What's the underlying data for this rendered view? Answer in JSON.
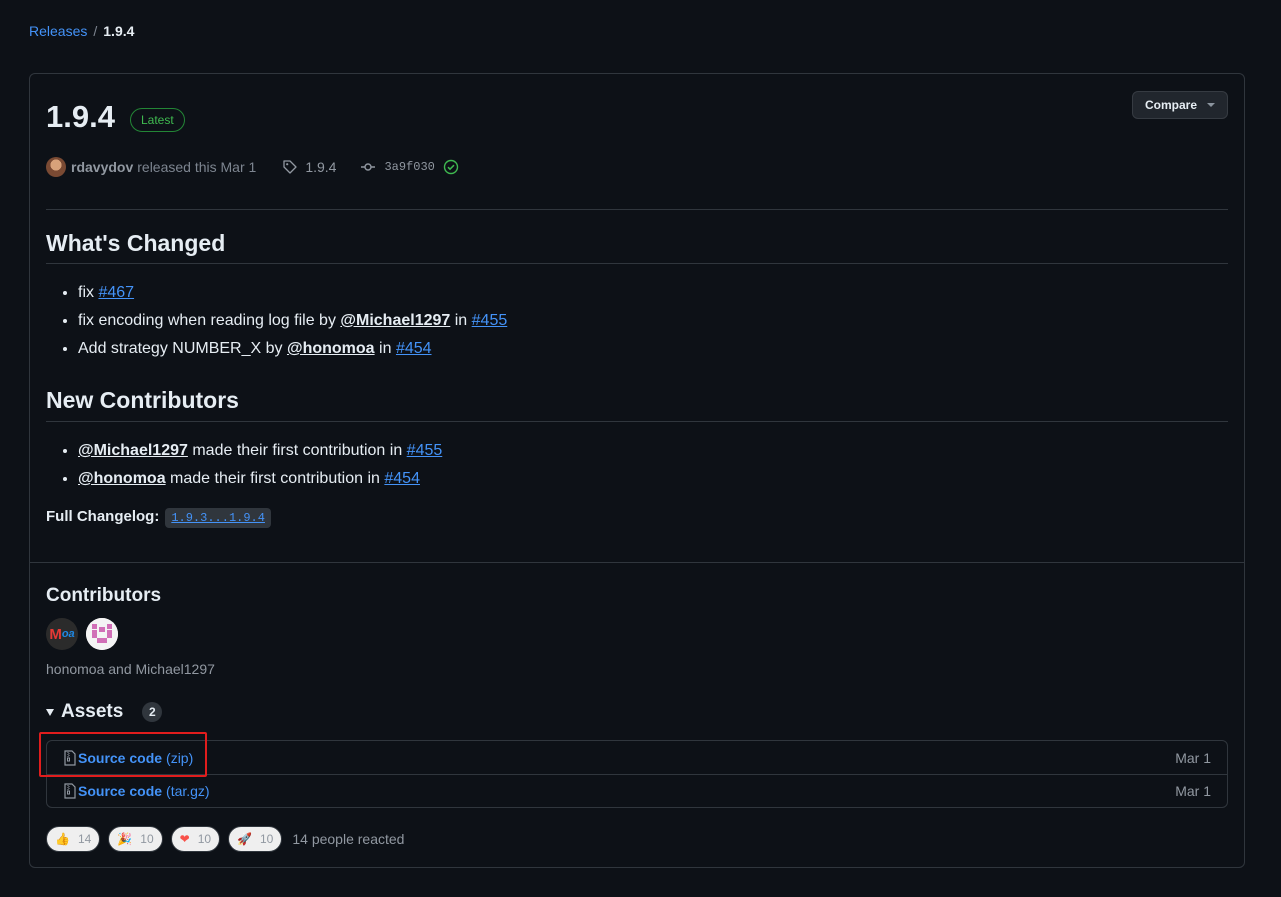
{
  "breadcrumb": {
    "releases": "Releases",
    "separator": "/",
    "current": "1.9.4"
  },
  "release": {
    "version": "1.9.4",
    "badge": "Latest",
    "compare_label": "Compare",
    "author": "rdavydov",
    "released_text": "released this Mar 1",
    "tag": "1.9.4",
    "commit": "3a9f030"
  },
  "whats_changed": {
    "title": "What's Changed",
    "items": [
      {
        "text": "fix",
        "link": "#467"
      },
      {
        "text": "fix encoding when reading log file by",
        "mention": "@Michael1297",
        "in": "in",
        "link": "#455"
      },
      {
        "text": "Add strategy NUMBER_X by",
        "mention": "@honomoa",
        "in": "in",
        "link": "#454"
      }
    ]
  },
  "new_contributors": {
    "title": "New Contributors",
    "items": [
      {
        "mention": "@Michael1297",
        "text": "made their first contribution in",
        "link": "#455"
      },
      {
        "mention": "@honomoa",
        "text": "made their first contribution in",
        "link": "#454"
      }
    ]
  },
  "changelog": {
    "label": "Full Changelog:",
    "range": "1.9.3...1.9.4"
  },
  "contributors": {
    "title": "Contributors",
    "names": "honomoa and Michael1297"
  },
  "assets": {
    "title": "Assets",
    "count": "2",
    "rows": [
      {
        "name": "Source code",
        "ext": "(zip)",
        "date": "Mar 1"
      },
      {
        "name": "Source code",
        "ext": "(tar.gz)",
        "date": "Mar 1"
      }
    ]
  },
  "reactions": {
    "items": [
      {
        "emoji": "👍",
        "count": "14"
      },
      {
        "emoji": "🎉",
        "count": "10"
      },
      {
        "emoji": "❤",
        "count": "10"
      },
      {
        "emoji": "🚀",
        "count": "10"
      }
    ],
    "summary": "14 people reacted"
  },
  "colors": {
    "accent": "#4493f8",
    "latest_green": "#3fb950",
    "highlight_red": "#e11d1d"
  }
}
